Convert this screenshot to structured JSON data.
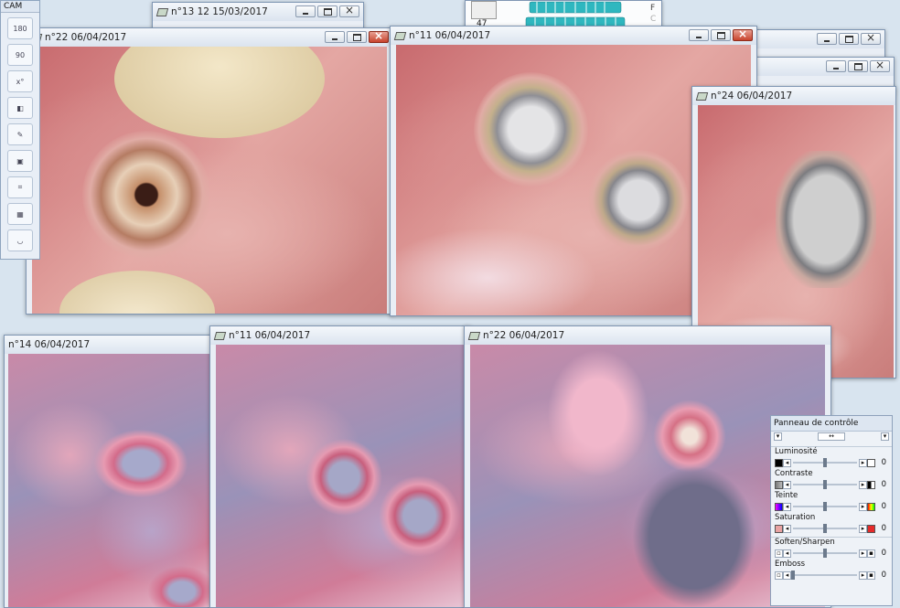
{
  "toolbar": {
    "title": "CAM",
    "tools": [
      {
        "name": "rotate-180",
        "label": "180"
      },
      {
        "name": "rotate-90",
        "label": "90"
      },
      {
        "name": "rotate-custom",
        "label": "x°"
      },
      {
        "name": "mirror",
        "label": ""
      },
      {
        "name": "pen",
        "label": ""
      },
      {
        "name": "image-adjust",
        "label": ""
      },
      {
        "name": "crop",
        "label": ""
      },
      {
        "name": "frame-select",
        "label": ""
      },
      {
        "name": "smile",
        "label": ""
      }
    ]
  },
  "odontogram": {
    "tooth_number": "47",
    "side_letters": [
      "F",
      "C"
    ]
  },
  "windows": [
    {
      "id": "w13",
      "title": "n°13 12 15/03/2017"
    },
    {
      "id": "w22a",
      "title": "n°22 06/04/2017"
    },
    {
      "id": "w11a",
      "title": "n°11 06/04/2017"
    },
    {
      "id": "w24",
      "title": "n°24 06/04/2017"
    },
    {
      "id": "w14",
      "title": "n°14 06/04/2017"
    },
    {
      "id": "w11b",
      "title": "n°11 06/04/2017"
    },
    {
      "id": "w22b",
      "title": "n°22 06/04/2017"
    }
  ],
  "control_panel": {
    "title": "Panneau de contrôle",
    "sliders": [
      {
        "label": "Luminosité",
        "value": "0",
        "level": 0.5
      },
      {
        "label": "Contraste",
        "value": "0",
        "level": 0.5
      },
      {
        "label": "Teinte",
        "value": "0",
        "level": 0.5
      },
      {
        "label": "Saturation",
        "value": "0",
        "level": 0.5
      }
    ],
    "filters": [
      {
        "label": "Soften/Sharpen",
        "value": "0",
        "level": 0.5
      },
      {
        "label": "Emboss",
        "value": "0",
        "level": 0.0
      }
    ]
  },
  "colors": {
    "window_frame": "#7f96b3",
    "close_button": "#c8442d",
    "odontogram_teeth": "#2fb7bf"
  }
}
